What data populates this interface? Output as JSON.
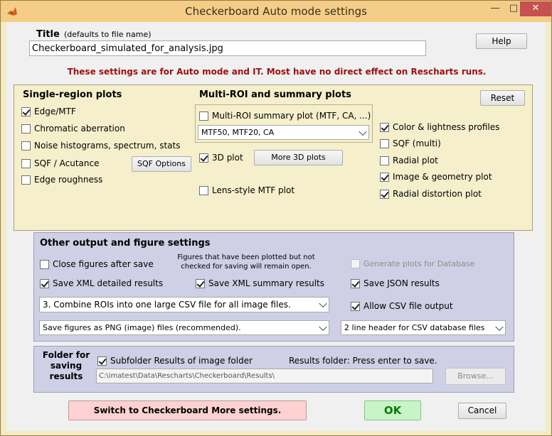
{
  "window": {
    "title": "Checkerboard Auto mode settings",
    "icon": "matlab-icon",
    "minimize_glyph": "—",
    "maximize_glyph": "□",
    "close_glyph": "✕"
  },
  "title_section": {
    "label": "Title",
    "hint": "(defaults to file name)",
    "value": "Checkerboard_simulated_for_analysis.jpg"
  },
  "help_button": "Help",
  "notice": "These settings are for Auto mode and IT. Most have no direct effect on Rescharts runs.",
  "single_region": {
    "heading": "Single-region plots",
    "items": [
      {
        "label": "Edge/MTF",
        "checked": true
      },
      {
        "label": "Chromatic aberration",
        "checked": false
      },
      {
        "label": "Noise histograms, spectrum, stats",
        "checked": false
      },
      {
        "label": "SQF / Acutance",
        "checked": false
      },
      {
        "label": "Edge roughness",
        "checked": false
      }
    ],
    "sqf_options_button": "SQF Options"
  },
  "multi_roi": {
    "heading": "Multi-ROI and summary plots",
    "summary_plot": {
      "label": "Multi-ROI summary plot (MTF, CA, ...)",
      "checked": false
    },
    "summary_select": "MTF50, MTF20, CA",
    "plot_3d": {
      "label": "3D plot",
      "checked": true
    },
    "more_3d_button": "More 3D plots",
    "lens_style": {
      "label": "Lens-style MTF plot",
      "checked": false
    }
  },
  "reset_button": "Reset",
  "right_column": {
    "items": [
      {
        "label": "Color & lightness profiles",
        "checked": true
      },
      {
        "label": "SQF (multi)",
        "checked": false
      },
      {
        "label": "Radial plot",
        "checked": false
      },
      {
        "label": "Image & geometry plot",
        "checked": true
      },
      {
        "label": "Radial distortion plot",
        "checked": true
      }
    ]
  },
  "other_output": {
    "heading": "Other output and figure settings",
    "close_figures": {
      "label": "Close figures after save",
      "checked": false
    },
    "note_line1": "Figures that have been plotted but not",
    "note_line2": "checked for saving will remain open.",
    "generate_db": {
      "label": "Generate plots for Database",
      "checked": false,
      "disabled": true
    },
    "save_xml_detailed": {
      "label": "Save XML detailed results",
      "checked": true
    },
    "save_xml_summary": {
      "label": "Save XML summary results",
      "checked": true
    },
    "save_json": {
      "label": "Save JSON results",
      "checked": true
    },
    "csv_select": "3. Combine ROIs into one large CSV file for all image files.",
    "allow_csv": {
      "label": "Allow CSV file output",
      "checked": true
    },
    "figures_select": "Save figures as PNG (image) files (recommended).",
    "header_select": "2 line header for CSV database files"
  },
  "folder": {
    "heading_line1": "Folder for",
    "heading_line2": "saving",
    "heading_line3": "results",
    "subfolder": {
      "label": "Subfolder Results of image folder",
      "checked": true
    },
    "results_folder_note": "Results folder:  Press enter to save.",
    "path": "C:\\imatest\\Data\\Rescharts\\Checkerboard\\Results\\",
    "browse_button": "Browse..."
  },
  "footer": {
    "switch_button": "Switch to Checkerboard More settings.",
    "ok_button": "OK",
    "cancel_button": "Cancel"
  },
  "colors": {
    "titlebar": "#f4cd88",
    "notice_text": "#a01010",
    "panel_yellow": "#f5efcc",
    "panel_blue": "#cfcfe5",
    "switch_button_bg": "#ffd2d2",
    "ok_button_bg": "#c7f5c7"
  }
}
